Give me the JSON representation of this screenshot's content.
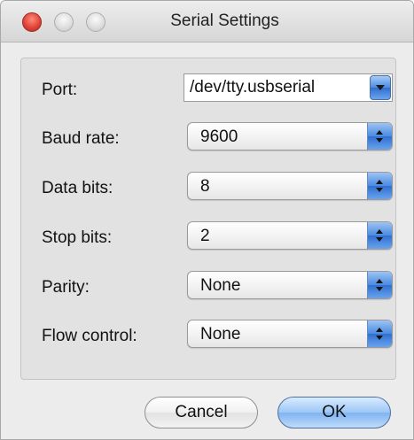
{
  "window": {
    "title": "Serial Settings"
  },
  "fields": [
    {
      "label": "Port:",
      "value": "/dev/tty.usbserial"
    },
    {
      "label": "Baud rate:",
      "value": "9600"
    },
    {
      "label": "Data bits:",
      "value": "8"
    },
    {
      "label": "Stop bits:",
      "value": "2"
    },
    {
      "label": "Parity:",
      "value": "None"
    },
    {
      "label": "Flow control:",
      "value": "None"
    }
  ],
  "buttons": {
    "cancel": "Cancel",
    "ok": "OK"
  },
  "colors": {
    "accent": "#4b8be0",
    "close_button": "#e0463a"
  },
  "icons": {
    "close": "close-icon",
    "minimize": "minimize-icon",
    "zoom": "zoom-icon",
    "popup_arrows": "up-down-chevron-icon",
    "combo_arrow": "chevron-down-icon"
  }
}
